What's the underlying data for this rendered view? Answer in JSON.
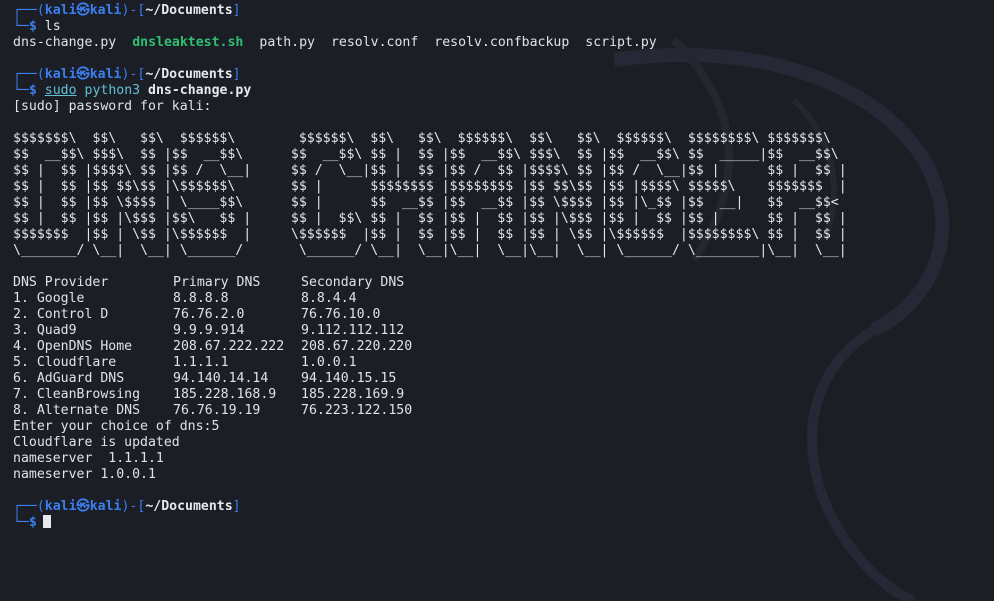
{
  "prompt": {
    "user": "kali",
    "host": "kali",
    "cwd": "~/Documents",
    "dollar": "$"
  },
  "cmd1": {
    "text": "ls"
  },
  "ls_output": [
    {
      "name": "dns-change.py",
      "exec": false
    },
    {
      "name": "dnsleaktest.sh",
      "exec": true
    },
    {
      "name": "path.py",
      "exec": false
    },
    {
      "name": "resolv.conf",
      "exec": false
    },
    {
      "name": "resolv.confbackup",
      "exec": false
    },
    {
      "name": "script.py",
      "exec": false
    }
  ],
  "cmd2": {
    "sudo": "sudo",
    "python": "python3",
    "script": "dns-change.py"
  },
  "sudo_prompt": "[sudo] password for kali:",
  "banner": [
    "$$$$$$$\\  $$\\   $$\\  $$$$$$\\        $$$$$$\\  $$\\   $$\\  $$$$$$\\  $$\\   $$\\  $$$$$$\\  $$$$$$$$\\ $$$$$$$\\",
    "$$  __$$\\ $$$\\  $$ |$$  __$$\\      $$  __$$\\ $$ |  $$ |$$  __$$\\ $$$\\  $$ |$$  __$$\\ $$  _____|$$  __$$\\",
    "$$ |  $$ |$$$$\\ $$ |$$ /  \\__|     $$ /  \\__|$$ |  $$ |$$ /  $$ |$$$$\\ $$ |$$ /  \\__|$$ |      $$ |  $$ |",
    "$$ |  $$ |$$ $$\\$$ |\\$$$$$$\\       $$ |      $$$$$$$$ |$$$$$$$$ |$$ $$\\$$ |$$ |$$$$\\ $$$$$\\    $$$$$$$  |",
    "$$ |  $$ |$$ \\$$$$ | \\____$$\\      $$ |      $$  __$$ |$$  __$$ |$$ \\$$$$ |$$ |\\_$$ |$$  __|   $$  __$$<",
    "$$ |  $$ |$$ |\\$$$ |$$\\   $$ |     $$ |  $$\\ $$ |  $$ |$$ |  $$ |$$ |\\$$$ |$$ |  $$ |$$ |      $$ |  $$ |",
    "$$$$$$$  |$$ | \\$$ |\\$$$$$$  |     \\$$$$$$  |$$ |  $$ |$$ |  $$ |$$ | \\$$ |\\$$$$$$  |$$$$$$$$\\ $$ |  $$ |",
    "\\_______/ \\__|  \\__| \\______/       \\______/ \\__|  \\__|\\__|  \\__|\\__|  \\__| \\______/ \\________|\\__|  \\__|"
  ],
  "table": {
    "headers": [
      "DNS Provider",
      "Primary DNS",
      "Secondary DNS"
    ],
    "rows": [
      [
        "1. Google",
        "8.8.8.8",
        "8.8.4.4"
      ],
      [
        "2. Control D",
        "76.76.2.0",
        "76.76.10.0"
      ],
      [
        "3. Quad9",
        "9.9.9.914",
        "9.112.112.112"
      ],
      [
        "4. OpenDNS Home",
        "208.67.222.222",
        "208.67.220.220"
      ],
      [
        "5. Cloudflare",
        "1.1.1.1",
        "1.0.0.1"
      ],
      [
        "6. AdGuard DNS",
        "94.140.14.14",
        "94.140.15.15"
      ],
      [
        "7. CleanBrowsing",
        "185.228.168.9",
        "185.228.169.9"
      ],
      [
        "8. Alternate DNS",
        "76.76.19.19",
        "76.223.122.150"
      ]
    ]
  },
  "choice_line": "Enter your choice of dns:5",
  "updated_line": "Cloudflare is updated",
  "nameserver_lines": [
    "nameserver  1.1.1.1",
    "nameserver 1.0.0.1"
  ]
}
